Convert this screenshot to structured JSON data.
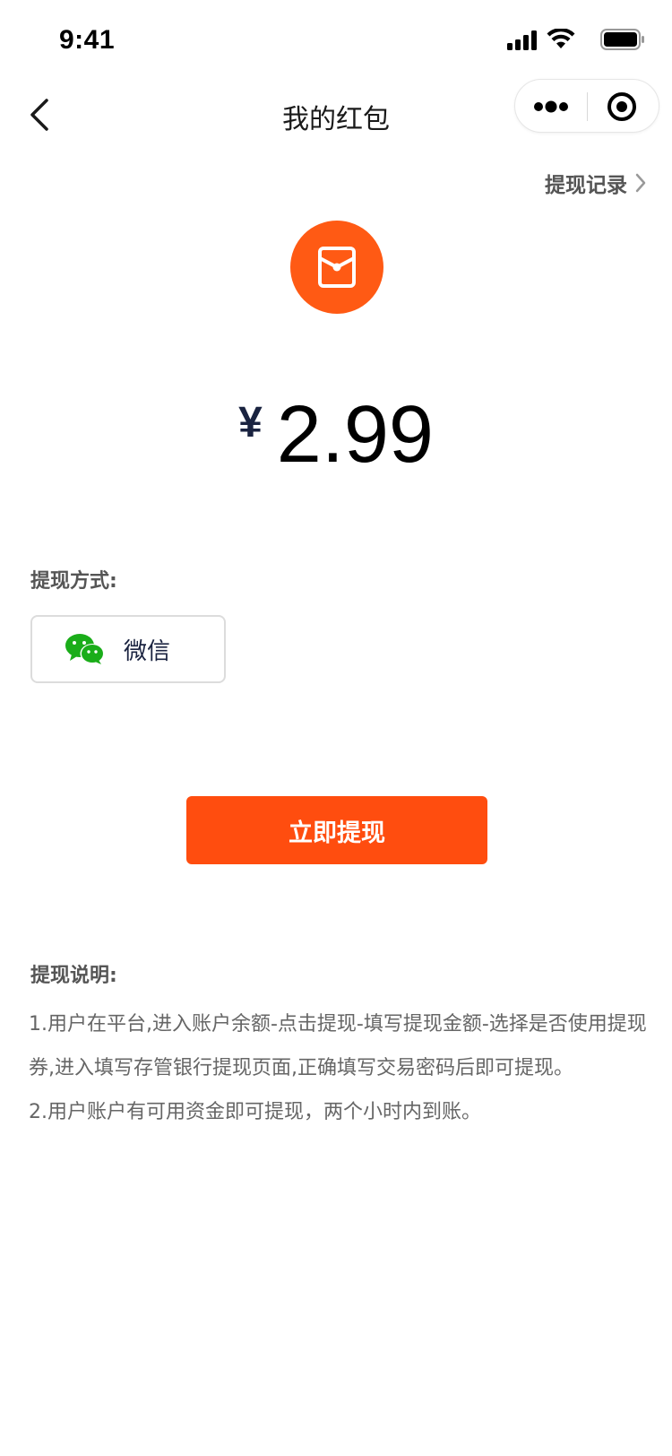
{
  "status_bar": {
    "time": "9:41"
  },
  "nav": {
    "title": "我的红包"
  },
  "history": {
    "label": "提现记录"
  },
  "balance": {
    "currency": "¥",
    "amount": "2.99"
  },
  "withdraw_method": {
    "label": "提现方式:",
    "option": "微信"
  },
  "actions": {
    "withdraw_label": "立即提现"
  },
  "notes": {
    "title": "提现说明:",
    "items": [
      "1.用户在平台,进入账户余额-点击提现-填写提现金额-选择是否使用提现券,进入填写存管银行提现页面,正确填写交易密码后即可提现。",
      "2.用户账户有可用资金即可提现，两个小时内到账。"
    ]
  },
  "colors": {
    "accent": "#ff4d0f",
    "badge": "#ff5a14",
    "wechat": "#1aad19"
  },
  "icons": [
    "signal-icon",
    "wifi-icon",
    "battery-icon",
    "back-arrow-icon",
    "more-icon",
    "close-target-icon",
    "chevron-right-icon",
    "red-envelope-icon",
    "wechat-icon"
  ]
}
